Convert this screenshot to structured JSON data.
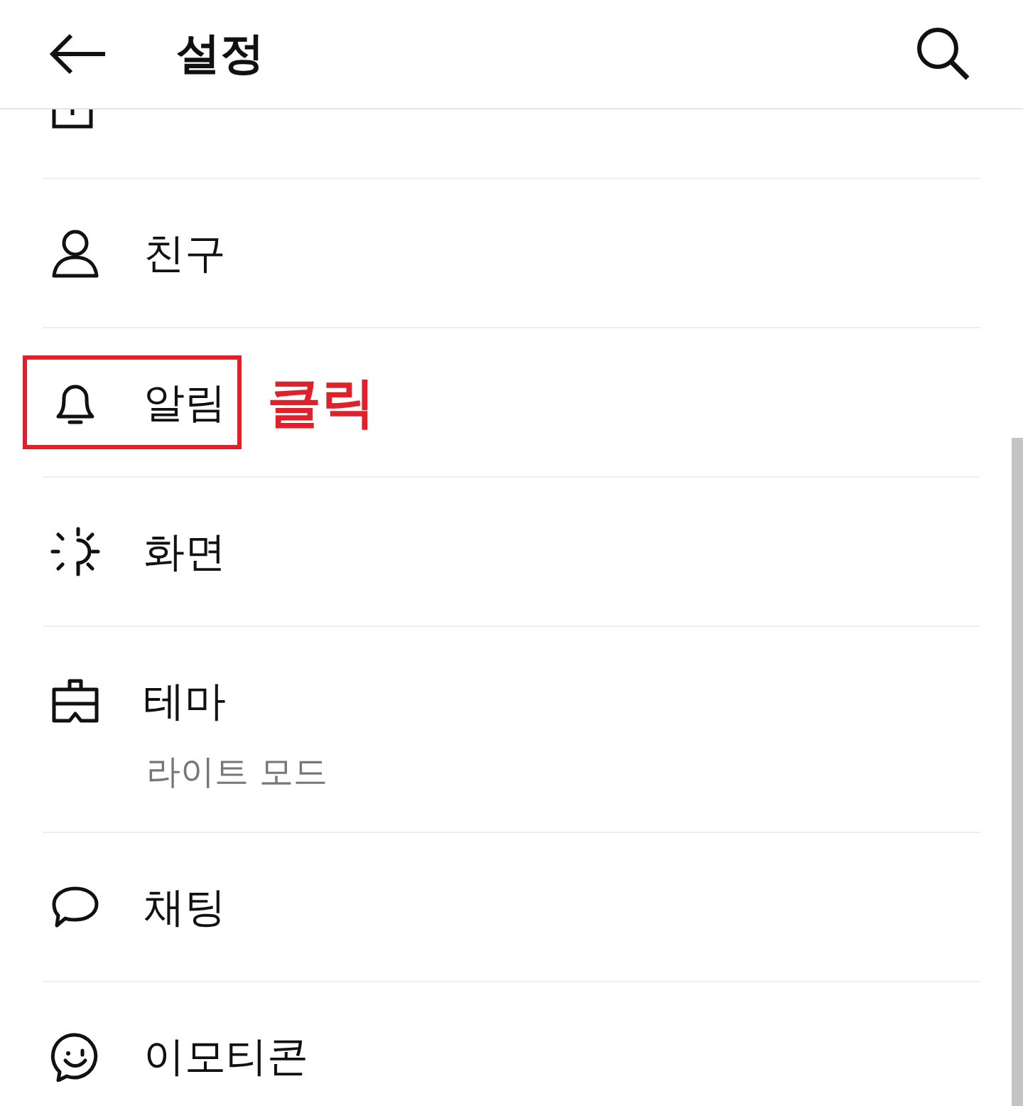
{
  "header": {
    "title": "설정"
  },
  "items": [
    {
      "label": "친구",
      "highlighted": false
    },
    {
      "label": "알림",
      "highlighted": true,
      "annotation": "클릭"
    },
    {
      "label": "화면",
      "highlighted": false
    },
    {
      "label": "테마",
      "sublabel": "라이트 모드",
      "highlighted": false
    },
    {
      "label": "채팅",
      "highlighted": false
    },
    {
      "label": "이모티콘",
      "highlighted": false
    }
  ]
}
